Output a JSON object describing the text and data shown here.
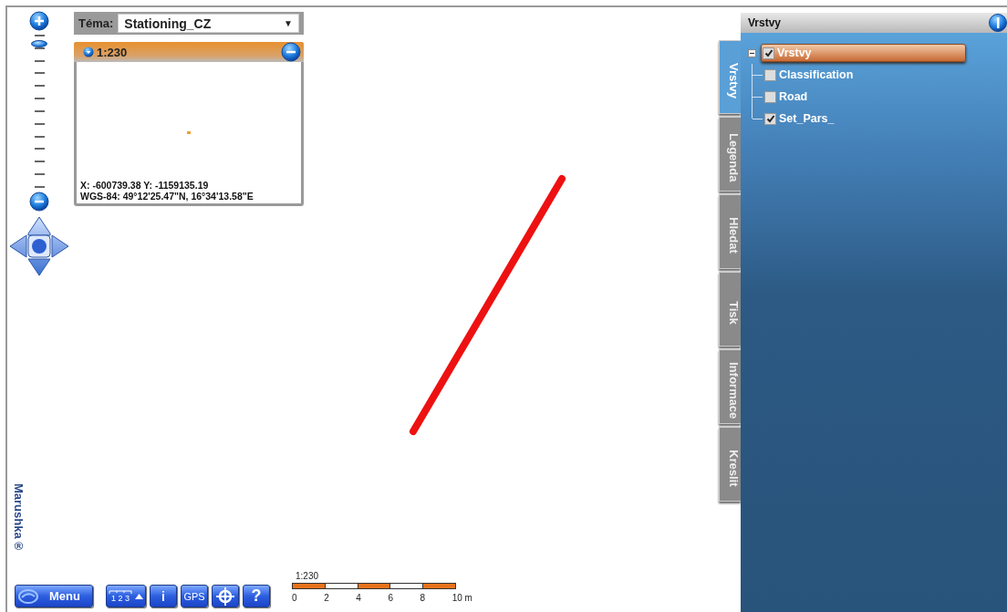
{
  "zoom": {
    "level": 0.95
  },
  "theme": {
    "label": "Téma:",
    "value": "Stationing_CZ",
    "caret": "▼"
  },
  "overview": {
    "scale": "1:230",
    "coordinates": "X: -600739.38 Y: -1159135.19",
    "wgs": "WGS-84: 49°12'25.47\"N, 16°34'13.58\"E"
  },
  "brand": "Marushka®",
  "toolbar": [
    {
      "kind": "menu",
      "label": "Menu"
    },
    {
      "kind": "measure",
      "label": "1 2 3"
    },
    {
      "kind": "text",
      "label": "i"
    },
    {
      "kind": "text",
      "label": "GPS"
    },
    {
      "kind": "locate"
    },
    {
      "kind": "text",
      "label": "?"
    }
  ],
  "scalebar": {
    "scale": "1:230",
    "ticks": [
      "0",
      "2",
      "4",
      "6",
      "8",
      "10 m"
    ]
  },
  "panel": {
    "title": "Vrstvy",
    "tabs": [
      {
        "label": "Vrstvy",
        "selected": true
      },
      {
        "label": "Legenda",
        "selected": false
      },
      {
        "label": "Hledat",
        "selected": false
      },
      {
        "label": "Tisk",
        "selected": false
      },
      {
        "label": "Informace",
        "selected": false
      },
      {
        "label": "Kreslit",
        "selected": false
      }
    ],
    "tree": {
      "label": "Vrstvy",
      "checked": true,
      "selected": true,
      "expanded": true,
      "children": [
        {
          "label": "Classification",
          "checked": false,
          "selected": false
        },
        {
          "label": "Road",
          "checked": false,
          "selected": false
        },
        {
          "label": "Set_Pars_",
          "checked": true,
          "selected": false
        }
      ]
    }
  }
}
